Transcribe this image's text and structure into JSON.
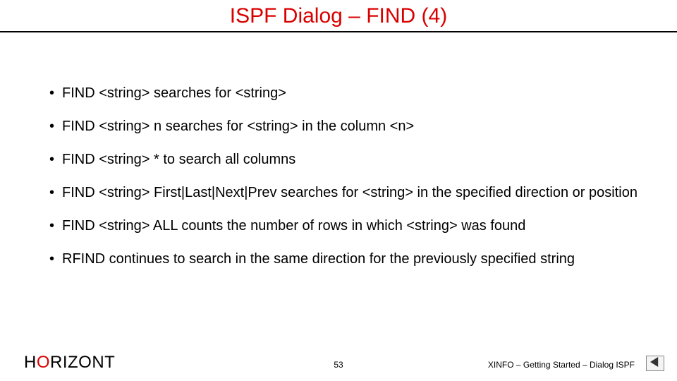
{
  "title": "ISPF Dialog – FIND (4)",
  "bullets": [
    "FIND <string> searches for <string>",
    "FIND <string> n searches for <string> in the column <n>",
    "FIND <string> * to search all columns",
    "FIND <string> First|Last|Next|Prev searches for <string> in the specified direction or position",
    "FIND <string> ALL counts the number of rows in which <string> was found",
    "RFIND continues to search in the same direction for the previously specified string"
  ],
  "footer": {
    "logo": {
      "h": "H",
      "o": "O",
      "rest": "RIZONT"
    },
    "page_number": "53",
    "doc_title": "XINFO – Getting Started – Dialog ISPF"
  }
}
